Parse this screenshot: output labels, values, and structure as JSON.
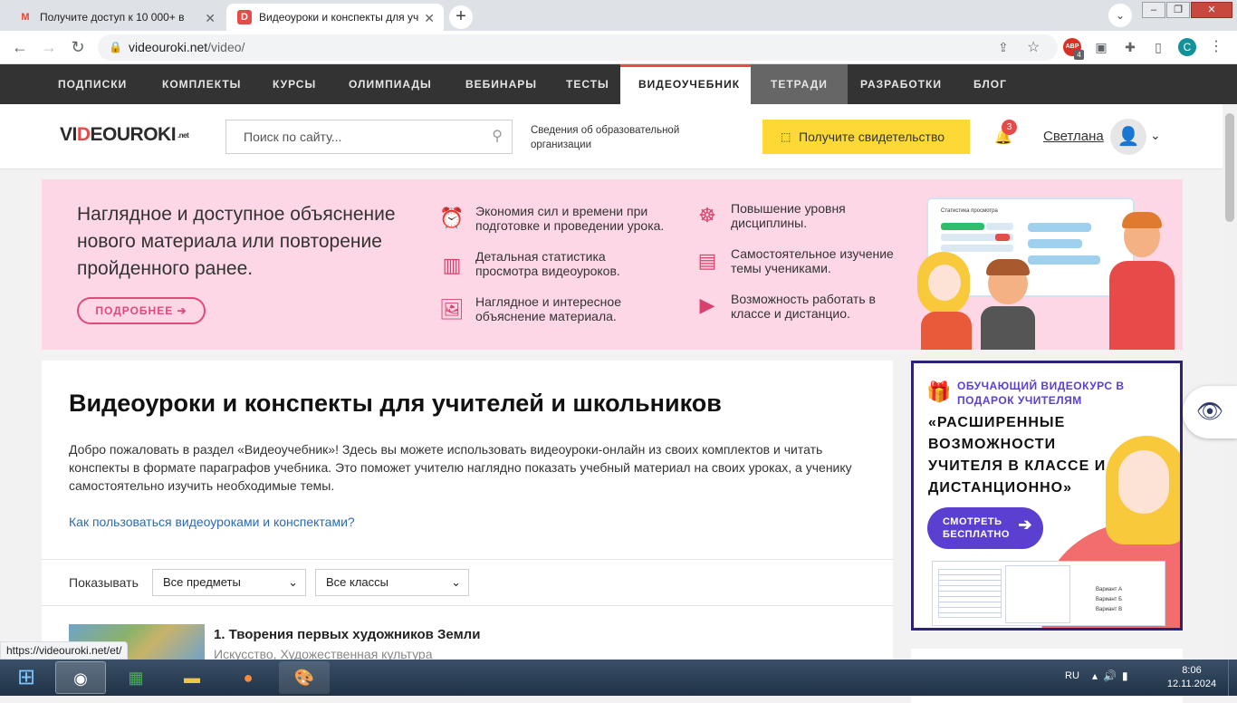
{
  "browser": {
    "tabs": [
      {
        "title": "Получите доступ к 10 000+ в",
        "favicon": "gmail-icon"
      },
      {
        "title": "Видеоуроки и конспекты для уч",
        "favicon": "videouroki-icon",
        "active": true
      }
    ],
    "new_tab": "+",
    "address": {
      "host": "videouroki.net",
      "path": "/video/"
    },
    "extension_badge_text": "ABP",
    "extension_badge_count": "4",
    "profile_initial": "С"
  },
  "site_nav": {
    "items": [
      "ПОДПИСКИ",
      "КОМПЛЕКТЫ",
      "КУРСЫ",
      "ОЛИМПИАДЫ",
      "ВЕБИНАРЫ",
      "ТЕСТЫ",
      "ВИДЕОУЧЕБНИК",
      "ТЕТРАДИ",
      "РАЗРАБОТКИ",
      "БЛОГ"
    ],
    "active": "ВИДЕОУЧЕБНИК"
  },
  "header": {
    "logo_left": "VI",
    "logo_accent": "D",
    "logo_right": "EOUROKI",
    "logo_suffix": ".net",
    "search_placeholder": "Поиск по сайту...",
    "org_info": "Сведения об образовательной организации",
    "cert_button": "Получите свидетельство",
    "notifications_count": "3",
    "user_name": "Светлана"
  },
  "banner": {
    "title": "Наглядное и доступное объяснение нового материала или повторение пройденного ранее.",
    "more_button": "ПОДРОБНЕЕ ➔",
    "features": [
      {
        "text": "Экономия сил и времени при подготовке и проведении урока.",
        "icon": "alarm-clock-icon"
      },
      {
        "text": "Детальная статистика просмотра видеоуроков.",
        "icon": "bar-chart-icon"
      },
      {
        "text": "Наглядное и интересное объяснение материала.",
        "icon": "image-icon"
      },
      {
        "text": "Повышение уровня дисциплины.",
        "icon": "meditation-icon"
      },
      {
        "text": "Самостоятельное изучение темы учениками.",
        "icon": "book-screen-icon"
      },
      {
        "text": "Возможность работать в классе и дистанцио.",
        "icon": "laptop-play-icon"
      }
    ],
    "illustration_caption": "Статистика просмотра"
  },
  "main": {
    "title": "Видеоуроки и конспекты для учителей и школьников",
    "intro": "Добро пожаловать в раздел «Видеоучебник»! Здесь вы можете использовать видеоуроки-онлайн из своих комплектов и читать конспекты в формате параграфов учебника. Это поможет учителю наглядно показать учебный материал на своих уроках, а ученику самостоятельно изучить необходимые темы.",
    "howto_link": "Как пользоваться видеоуроками и конспектами?",
    "filter_label": "Показывать",
    "subject_select": "Все предметы",
    "class_select": "Все классы",
    "lesson": {
      "title": "1. Творения первых художников Земли",
      "subtitle": "Искусство, Художественная культура"
    }
  },
  "ad": {
    "kicker": "ОБУЧАЮЩИЙ ВИДЕОКУРС В ПОДАРОК УЧИТЕЛЯМ",
    "title": "«РАСШИРЕННЫЕ ВОЗМОЖНОСТИ УЧИТЕЛЯ В КЛАССЕ И ДИСТАНЦИОННО»",
    "button": "СМОТРЕТЬ БЕСПЛАТНО",
    "options": [
      "Вариант А",
      "Вариант Б",
      "Вариант В"
    ]
  },
  "status_url": "https://videouroki.net/et/",
  "taskbar": {
    "apps": [
      "chrome-icon",
      "excel-icon",
      "explorer-icon",
      "firefox-icon",
      "paint-icon"
    ],
    "lang": "RU",
    "time": "8:06",
    "date": "12.11.2024"
  },
  "colors": {
    "accent_red": "#e84a4a",
    "cert_yellow": "#fcd934",
    "banner_pink": "#fdd7e6",
    "ad_purple": "#5a3fd1",
    "link_blue": "#2a6bb5"
  }
}
